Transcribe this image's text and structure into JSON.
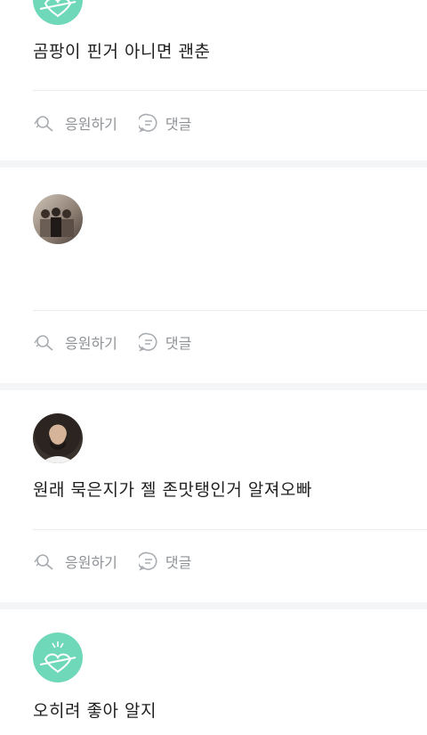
{
  "posts": [
    {
      "text": "곰팡이 핀거 아니면 괜춘",
      "actions": {
        "cheer_label": "응원하기",
        "comment_label": "댓글"
      }
    },
    {
      "text": "",
      "actions": {
        "cheer_label": "응원하기",
        "comment_label": "댓글"
      }
    },
    {
      "text": "원래 묵은지가 젤 존맛탱인거 알져오빠",
      "actions": {
        "cheer_label": "응원하기",
        "comment_label": "댓글"
      }
    },
    {
      "text": "오히려 좋아 알지"
    }
  ],
  "colors": {
    "background": "#f4f5f7",
    "card": "#ffffff",
    "text": "#1f1f1f",
    "action_text": "#8e9296",
    "mint_avatar": "#6fd8b8"
  }
}
